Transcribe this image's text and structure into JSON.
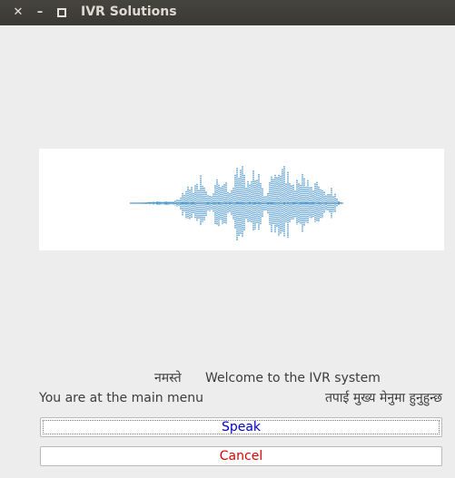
{
  "window": {
    "title": "IVR Solutions",
    "controls": [
      "close-icon",
      "minimize-icon",
      "maximize-icon"
    ]
  },
  "waveform": {
    "image": "sound-waveform",
    "color": "#2b82c0"
  },
  "labels": {
    "greeting_nepali": "नमस्ते",
    "greeting_english": "Welcome to the IVR system",
    "menu_english": "You are at the main menu",
    "menu_nepali": "तपाई मुख्य मेनुमा हुनुहुन्छ"
  },
  "buttons": {
    "speak": "Speak",
    "cancel": "Cancel"
  },
  "colors": {
    "speak_text": "#0000cc",
    "cancel_text": "#e00000",
    "titlebar": "#3c3b37",
    "window_bg": "#ededed"
  }
}
